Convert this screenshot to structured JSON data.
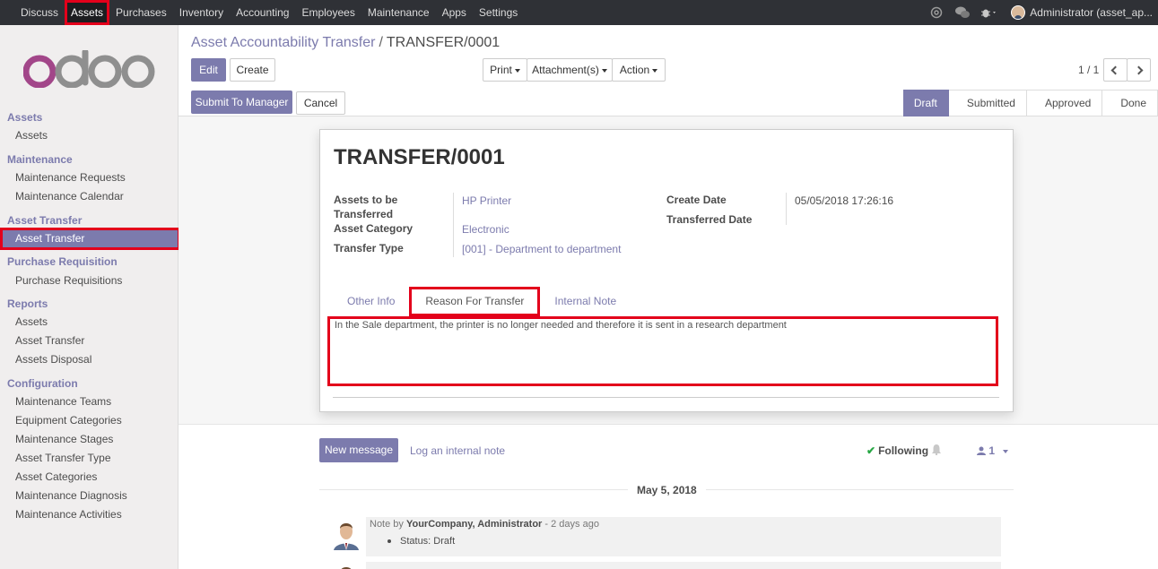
{
  "topnav": {
    "items": [
      "Discuss",
      "Assets",
      "Purchases",
      "Inventory",
      "Accounting",
      "Employees",
      "Maintenance",
      "Apps",
      "Settings"
    ],
    "active": "Assets",
    "user": "Administrator (asset_ap..."
  },
  "sidebar": {
    "sections": [
      {
        "title": "Assets",
        "items": [
          "Assets"
        ]
      },
      {
        "title": "Maintenance",
        "items": [
          "Maintenance Requests",
          "Maintenance Calendar"
        ]
      },
      {
        "title": "Asset Transfer",
        "items": [
          "Asset Transfer"
        ]
      },
      {
        "title": "Purchase Requisition",
        "items": [
          "Purchase Requisitions"
        ]
      },
      {
        "title": "Reports",
        "items": [
          "Assets",
          "Asset Transfer",
          "Assets Disposal"
        ]
      },
      {
        "title": "Configuration",
        "items": [
          "Maintenance Teams",
          "Equipment Categories",
          "Maintenance Stages",
          "Asset Transfer Type",
          "Asset Categories",
          "Maintenance Diagnosis",
          "Maintenance Activities"
        ]
      }
    ]
  },
  "breadcrumb": {
    "parent": "Asset Accountability Transfer",
    "separator": "/",
    "current": "TRANSFER/0001"
  },
  "toolbar": {
    "edit": "Edit",
    "create": "Create",
    "print": "Print",
    "attachments": "Attachment(s)",
    "action": "Action"
  },
  "pager": {
    "text": "1 / 1"
  },
  "statusbar": {
    "submit": "Submit To Manager",
    "cancel": "Cancel",
    "stages": [
      "Draft",
      "Submitted",
      "Approved",
      "Done"
    ],
    "active_stage": "Draft"
  },
  "record": {
    "title": "TRANSFER/0001",
    "fields": {
      "assets_label_1": "Assets to be",
      "assets_label_2": "Transferred",
      "assets_value": "HP Printer",
      "category_label": "Asset Category",
      "category_value": "Electronic",
      "type_label": "Transfer Type",
      "type_value": "[001] - Department to department",
      "create_date_label": "Create Date",
      "create_date_value": "05/05/2018 17:26:16",
      "transferred_date_label": "Transferred Date"
    },
    "tabs": [
      "Other Info",
      "Reason For Transfer",
      "Internal Note"
    ],
    "active_tab": "Reason For Transfer",
    "reason_text": "In the Sale department, the printer is no longer needed and therefore it is sent in a research department"
  },
  "chatter": {
    "new_message": "New message",
    "log_note": "Log an internal note",
    "following": "Following",
    "followers_count": "1",
    "date_label": "May 5, 2018",
    "messages": [
      {
        "prefix": "Note by ",
        "author": "YourCompany, Administrator",
        "suffix": " - 2 days ago",
        "body": "Status: Draft"
      }
    ]
  },
  "colors": {
    "brand": "#7c7bad",
    "highlight": "#e3001b",
    "topbar": "#2f3136"
  }
}
